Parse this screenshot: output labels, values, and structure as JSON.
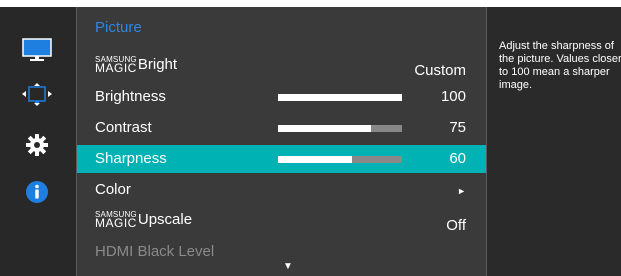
{
  "colors": {
    "accent_title": "#2f86e6",
    "selected_row": "#00b2b4",
    "background": "#2a2a2a",
    "menu_panel": "#3a3a3a"
  },
  "sidebar": {
    "icons": [
      "monitor-picture-icon",
      "screen-size-icon",
      "gear-icon",
      "info-icon"
    ],
    "active": "monitor-picture-icon"
  },
  "menu": {
    "title": "Picture",
    "magic_prefix_small": "SAMSUNG",
    "magic_prefix_large": "MAGIC",
    "items": [
      {
        "label": "Bright",
        "value": "Custom"
      },
      {
        "label": "Brightness",
        "value": "100",
        "level": 100
      },
      {
        "label": "Contrast",
        "value": "75",
        "level": 75
      },
      {
        "label": "Sharpness",
        "value": "60",
        "level": 60
      },
      {
        "label": "Color",
        "value": "►"
      },
      {
        "label": "Upscale",
        "value": "Off"
      },
      {
        "label": "HDMI Black Level",
        "value": ""
      }
    ],
    "selected_index": 3,
    "more_indicator": "▼"
  },
  "help": {
    "text": "Adjust the sharpness of the picture. Values closer to 100 mean a sharper image."
  }
}
